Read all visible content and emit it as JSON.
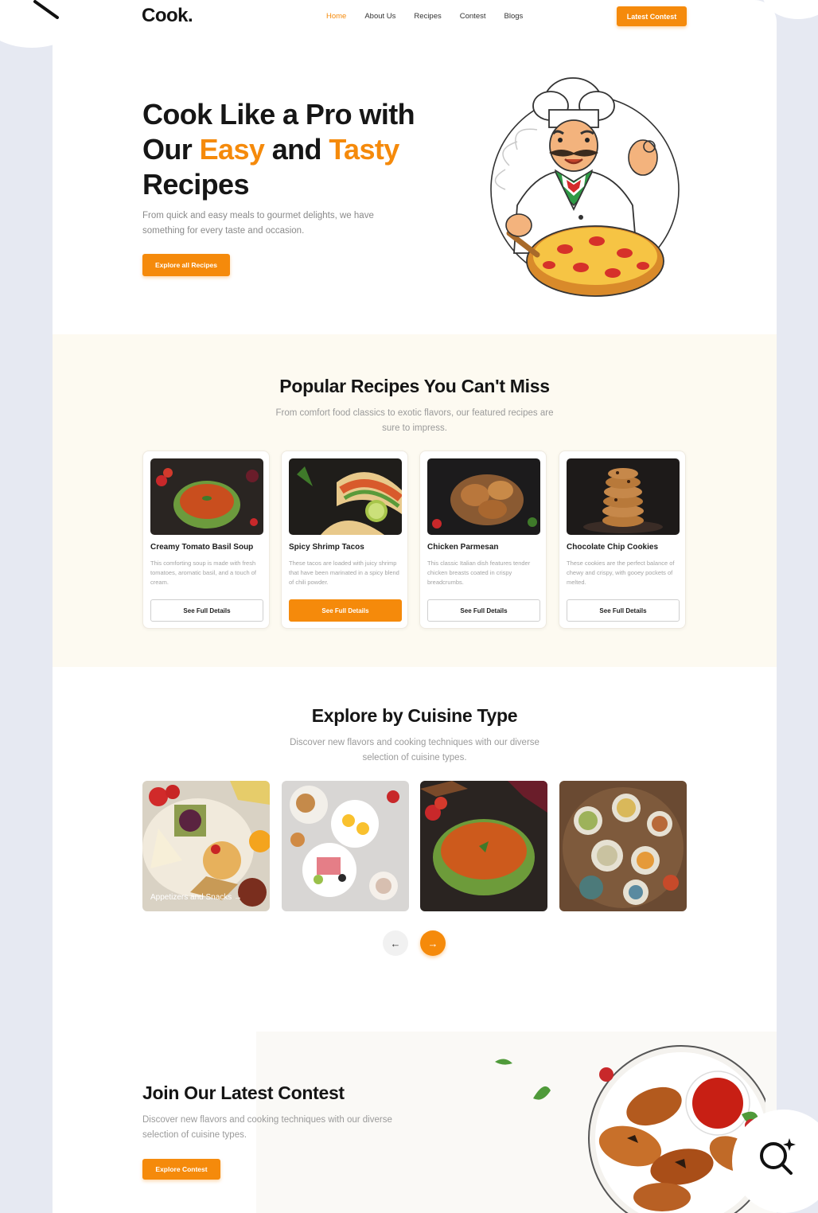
{
  "brand": {
    "logo": "Cook.",
    "accent_color": "#f58a0b"
  },
  "nav": {
    "links": [
      "Home",
      "About Us",
      "Recipes",
      "Contest",
      "Blogs"
    ],
    "active": "Home",
    "cta": "Latest Contest"
  },
  "hero": {
    "title_line1": "Cook Like a Pro with",
    "title_our": "Our ",
    "title_easy": "Easy",
    "title_and": " and ",
    "title_tasty": "Tasty",
    "title_line3": "Recipes",
    "subtitle": "From quick and easy meals to gourmet delights, we have something for every taste and occasion.",
    "button": "Explore all Recipes"
  },
  "popular": {
    "title": "Popular Recipes You Can't Miss",
    "subtitle": "From comfort food classics to exotic flavors, our featured recipes are sure to impress.",
    "cards": [
      {
        "name": "Creamy Tomato Basil Soup",
        "desc": "This comforting soup is made with fresh tomatoes, aromatic basil, and a touch of cream.",
        "button": "See Full Details"
      },
      {
        "name": "Spicy Shrimp Tacos",
        "desc": "These tacos are loaded with juicy shrimp that have been marinated in a spicy blend of chili powder.",
        "button": "See Full Details"
      },
      {
        "name": "Chicken Parmesan",
        "desc": "This classic Italian dish features tender chicken breasts coated in crispy breadcrumbs.",
        "button": "See Full Details"
      },
      {
        "name": "Chocolate Chip Cookies",
        "desc": "These cookies are the perfect balance of chewy and crispy, with gooey pockets of melted.",
        "button": "See Full Details"
      }
    ]
  },
  "cuisine": {
    "title": "Explore by Cuisine Type",
    "subtitle": "Discover new flavors and cooking techniques with our diverse selection of cuisine types.",
    "first_label": "Appetizers and Snacks →",
    "prev": "←",
    "next": "→"
  },
  "contest": {
    "title": "Join Our Latest Contest",
    "subtitle": "Discover new flavors and cooking techniques with our diverse selection of cuisine types.",
    "button": "Explore Contest"
  },
  "icons": {
    "back": "back-arrow-icon",
    "search": "visual-search-icon",
    "prev": "arrow-left-icon",
    "next": "arrow-right-icon"
  }
}
